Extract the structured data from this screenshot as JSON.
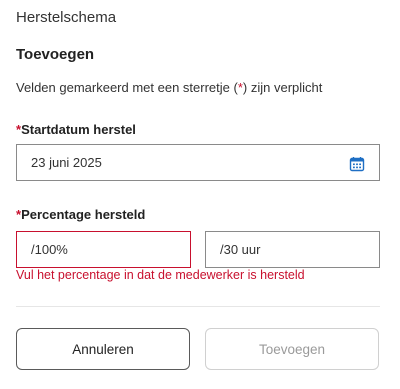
{
  "header": {
    "title": "Herstelschema"
  },
  "form": {
    "title": "Toevoegen",
    "required_note_before": "Velden gemarkeerd met een sterretje (",
    "required_star": "*",
    "required_note_after": ") zijn verplicht",
    "start_date": {
      "star": "*",
      "label": "Startdatum herstel",
      "value": "23 juni 2025",
      "icon": "calendar-icon"
    },
    "percentage": {
      "star": "*",
      "label": "Percentage hersteld",
      "percent_value": "/100%",
      "hours_value": "/30 uur",
      "error": "Vul het percentage in dat de medewerker is hersteld"
    }
  },
  "buttons": {
    "cancel": "Annuleren",
    "add": "Toevoegen"
  },
  "colors": {
    "error": "#c8102e",
    "accent": "#1f6fc4",
    "disabled_text": "#9a9a9a"
  }
}
